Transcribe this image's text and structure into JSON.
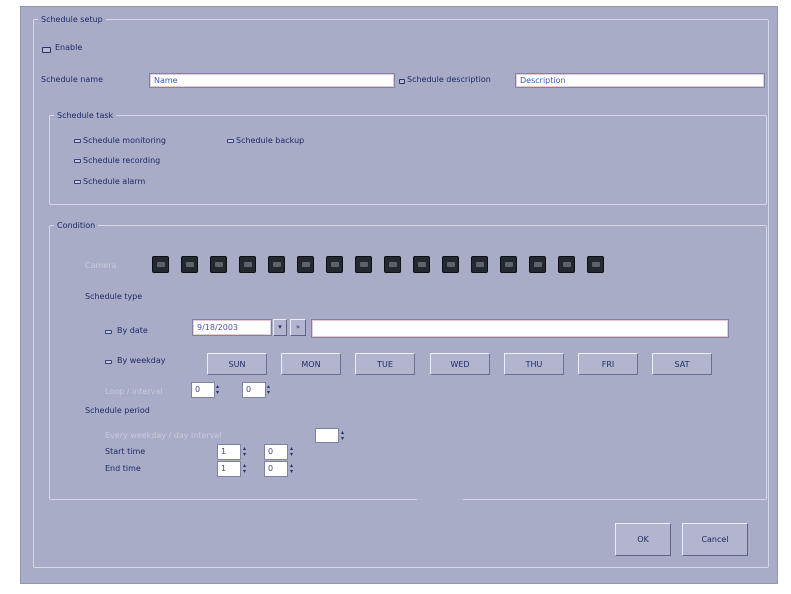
{
  "schedule_setup": {
    "legend": "Schedule setup",
    "enable_label": "Enable",
    "name_label": "Schedule name",
    "name_value": "Name",
    "description_label": "Schedule description",
    "description_value": "Description"
  },
  "task": {
    "legend": "Schedule task",
    "options": [
      "Schedule monitoring",
      "Schedule recording",
      "Schedule alarm",
      "Schedule backup"
    ]
  },
  "condition": {
    "legend": "Condition",
    "camera_label": "Camera",
    "camera_count": 16,
    "schedule_type_label": "Schedule type",
    "by_date_label": "By date",
    "date_value": "9/18/2003",
    "by_weekday_label": "By weekday",
    "weekdays": [
      "SUN",
      "MON",
      "TUE",
      "WED",
      "THU",
      "FRI",
      "SAT"
    ],
    "loop_label": "Loop / interval",
    "loop_value_1": "0",
    "loop_value_2": "0",
    "period_label": "Schedule period",
    "period_sub_label": "Every weekday / day interval",
    "start_label": "Start time",
    "end_label": "End time",
    "start_hour": "1",
    "start_min": "0",
    "end_hour": "1",
    "end_min": "0"
  },
  "buttons": {
    "ok": "OK",
    "cancel": "Cancel"
  },
  "colors": {
    "window_bg": "#a8acc6",
    "text": "#1f2a6b",
    "camera_button": "#24282f",
    "input_accent": "#e9c9d2"
  }
}
